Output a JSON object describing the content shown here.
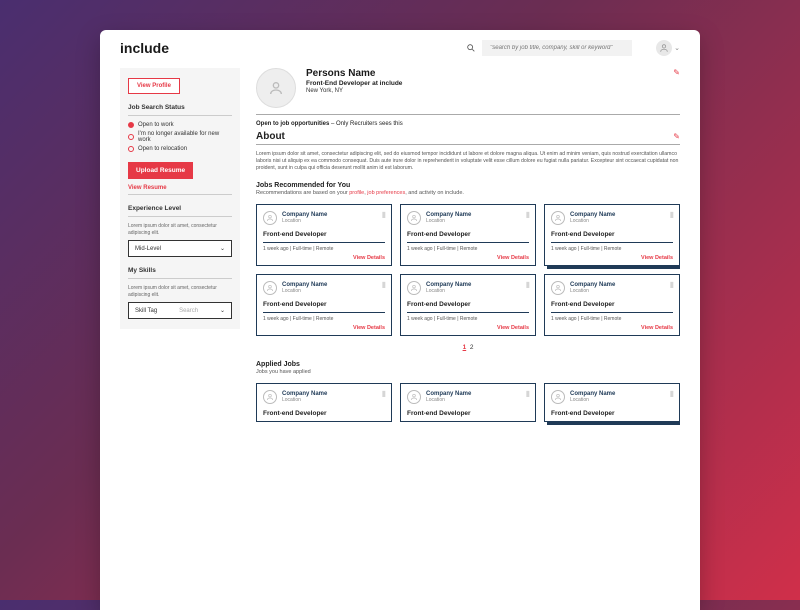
{
  "brand": "include",
  "search": {
    "placeholder": "\"search by job title, company, skill or keyword\""
  },
  "sidebar": {
    "view_profile": "View Profile",
    "status_label": "Job Search Status",
    "status_options": [
      "Open to work",
      "I'm no longer available for new work",
      "Open to relocation"
    ],
    "upload_resume": "Upload Resume",
    "view_resume": "View Resume",
    "exp_label": "Experience Level",
    "exp_hint": "Lorem ipsum dolor sit amet, consectetur adipiscing elit.",
    "exp_value": "Mid-Level",
    "skills_label": "My Skills",
    "skills_hint": "Lorem ipsum dolor sit amet, consectetur adipiscing elit.",
    "skill_tag": "Skill Tag",
    "skill_search": "Search"
  },
  "profile": {
    "name": "Persons Name",
    "title": "Front-End Developer at include",
    "location": "New York, NY",
    "open_line_bold": "Open to job opportunities",
    "open_line_rest": " – Only Recruiters sees this",
    "about_label": "About",
    "about_text": "Lorem ipsum dolor sit amet, consectetur adipiscing elit, sed do eiusmod tempor incididunt ut labore et dolore magna aliqua. Ut enim ad minim veniam, quis nostrud exercitation ullamco laboris nisi ut aliquip ex ea commodo consequat. Duis aute irure dolor in reprehenderit in voluptate velit esse cillum dolore eu fugiat nulla pariatur. Excepteur sint occaecat cupidatat non proident, sunt in culpa qui officia deserunt mollit anim id est laborum."
  },
  "recs": {
    "heading": "Jobs Recommended for You",
    "sub_pre": "Recommendations are based on your ",
    "sub_link1": "profile",
    "sub_sep": ", ",
    "sub_link2": "job preferences",
    "sub_post": ", and activity on include."
  },
  "card": {
    "company": "Company Name",
    "location": "Location",
    "role": "Front-end Developer",
    "meta": "1 week ago | Full-time | Remote",
    "view": "View Details"
  },
  "pager": {
    "p1": "1",
    "p2": "2"
  },
  "applied": {
    "heading": "Applied Jobs",
    "sub": "Jobs you have applied"
  }
}
